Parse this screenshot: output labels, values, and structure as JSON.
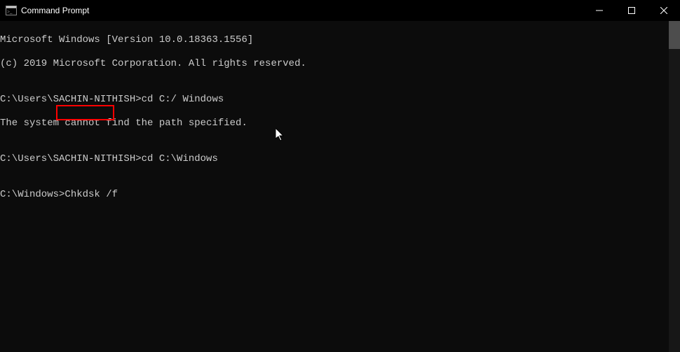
{
  "titlebar": {
    "title": "Command Prompt"
  },
  "terminal": {
    "lines": [
      "Microsoft Windows [Version 10.0.18363.1556]",
      "(c) 2019 Microsoft Corporation. All rights reserved.",
      "",
      "C:\\Users\\SACHIN-NITHISH>cd C:/ Windows",
      "The system cannot find the path specified.",
      "",
      "C:\\Users\\SACHIN-NITHISH>cd C:\\Windows",
      "",
      "C:\\Windows>Chkdsk /f"
    ],
    "highlighted_command": "Chkdsk /f"
  },
  "colors": {
    "background": "#0c0c0c",
    "text": "#cccccc",
    "highlight_border": "#ff0000",
    "titlebar_bg": "#000000"
  }
}
